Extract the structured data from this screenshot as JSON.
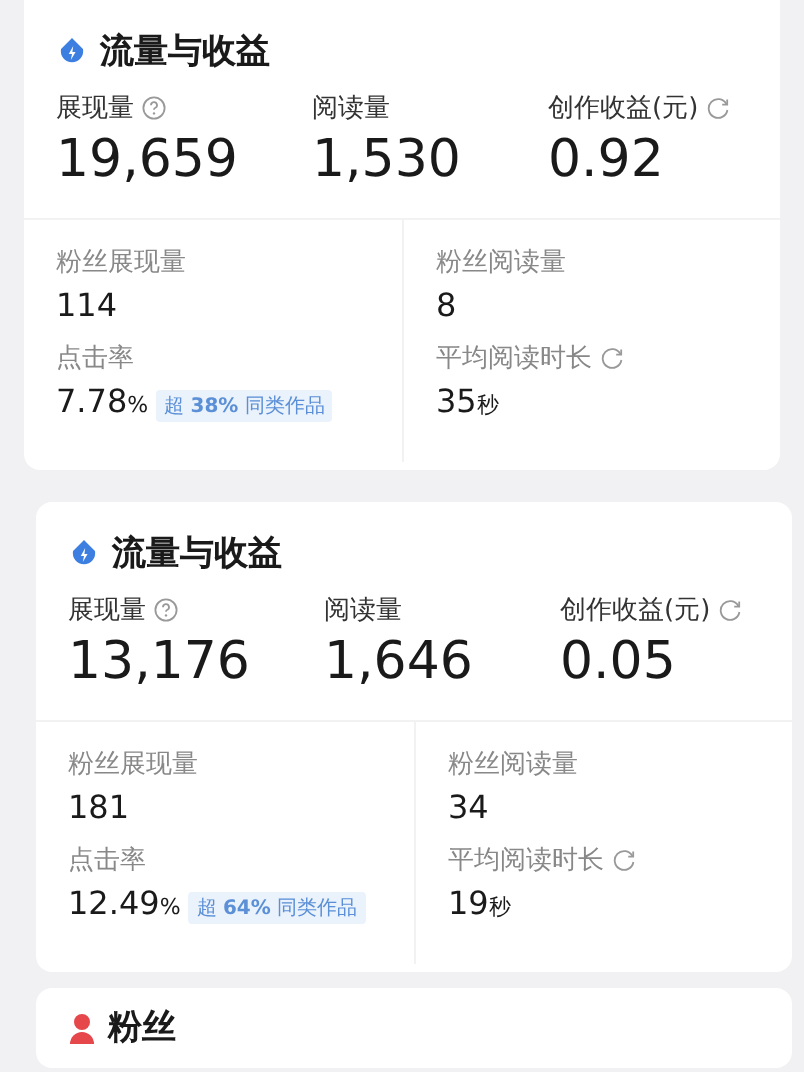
{
  "cards": [
    {
      "title": "流量与收益",
      "metrics": [
        {
          "kind": "info",
          "label": "展现量",
          "value": "19,659"
        },
        {
          "kind": "plain",
          "label": "阅读量",
          "value": "1,530"
        },
        {
          "kind": "updated",
          "label": "创作收益(元)",
          "value": "0.92"
        }
      ],
      "details": [
        {
          "kind": "plain",
          "label": "粉丝展现量",
          "value": "114"
        },
        {
          "kind": "plain",
          "label": "粉丝阅读量",
          "value": "8"
        },
        {
          "kind": "plain",
          "label": "点击率",
          "value": "7.78",
          "unit": "%",
          "badge": "超 **38%** 同类作品"
        },
        {
          "kind": "updated",
          "label": "平均阅读时长",
          "value": "35",
          "unit": "秒"
        }
      ]
    },
    {
      "title": "流量与收益",
      "metrics": [
        {
          "kind": "info",
          "label": "展现量",
          "value": "13,176"
        },
        {
          "kind": "plain",
          "label": "阅读量",
          "value": "1,646"
        },
        {
          "kind": "updated",
          "label": "创作收益(元)",
          "value": "0.05"
        }
      ],
      "details": [
        {
          "kind": "plain",
          "label": "粉丝展现量",
          "value": "181"
        },
        {
          "kind": "plain",
          "label": "粉丝阅读量",
          "value": "34"
        },
        {
          "kind": "plain",
          "label": "点击率",
          "value": "12.49",
          "unit": "%",
          "badge": "超 **64%** 同类作品"
        },
        {
          "kind": "updated",
          "label": "平均阅读时长",
          "value": "19",
          "unit": "秒"
        }
      ]
    }
  ],
  "fans_card": {
    "title": "粉丝"
  }
}
